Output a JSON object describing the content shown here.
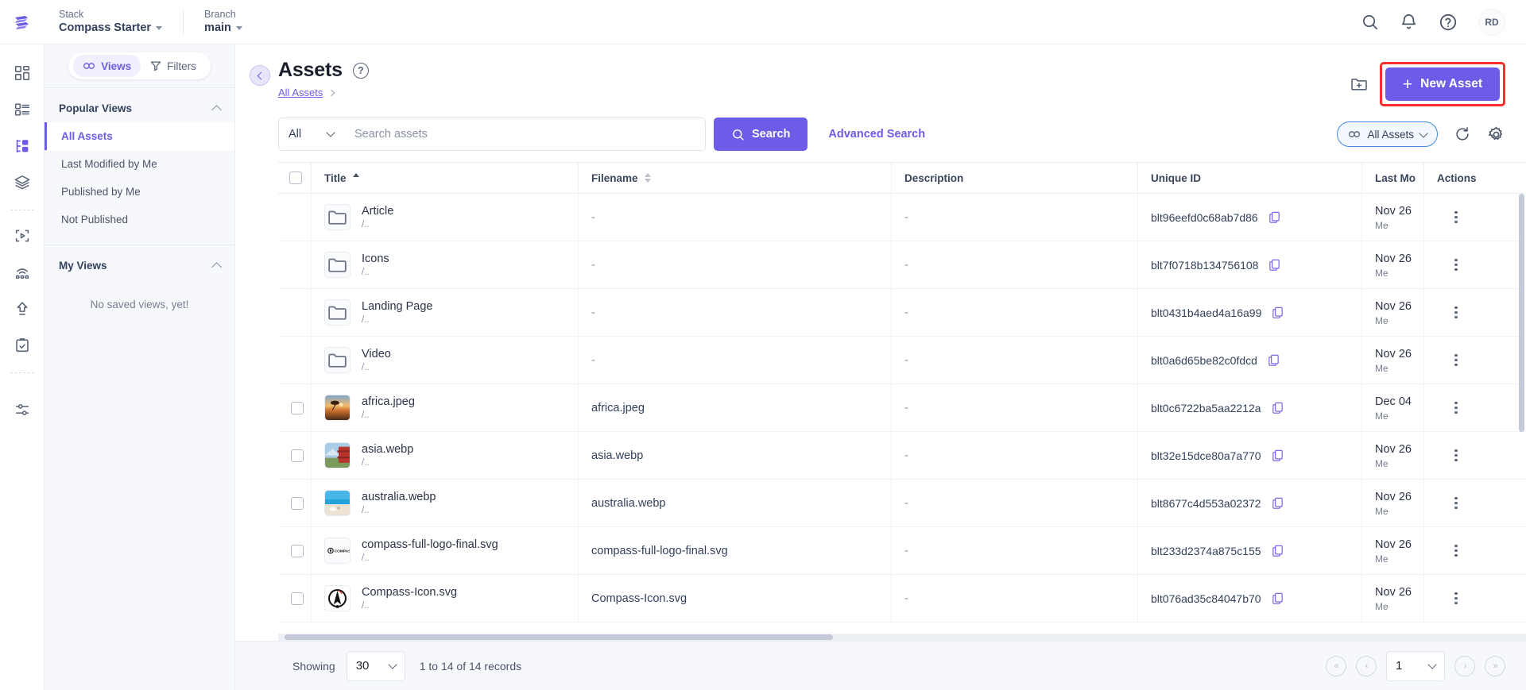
{
  "topbar": {
    "stack_label": "Stack",
    "stack_value": "Compass Starter",
    "branch_label": "Branch",
    "branch_value": "main",
    "avatar_initials": "RD"
  },
  "views_panel": {
    "views_button": "Views",
    "filters_button": "Filters",
    "popular_views_title": "Popular Views",
    "popular_views": [
      {
        "label": "All Assets",
        "active": true
      },
      {
        "label": "Last Modified by Me",
        "active": false
      },
      {
        "label": "Published by Me",
        "active": false
      },
      {
        "label": "Not Published",
        "active": false
      }
    ],
    "my_views_title": "My Views",
    "my_views_empty": "No saved views, yet!"
  },
  "header": {
    "title": "Assets",
    "breadcrumb": "All Assets",
    "new_asset_label": "New Asset",
    "new_asset_highlight_color": "#fc2d2d",
    "accent_color": "#6c5ce7"
  },
  "search": {
    "scope_value": "All",
    "placeholder": "Search assets",
    "value": "",
    "search_button": "Search",
    "advanced_search": "Advanced Search",
    "view_chip": "All Assets"
  },
  "table": {
    "columns": [
      {
        "key": "title",
        "label": "Title"
      },
      {
        "key": "filename",
        "label": "Filename"
      },
      {
        "key": "description",
        "label": "Description"
      },
      {
        "key": "unique_id",
        "label": "Unique ID"
      },
      {
        "key": "last_modified",
        "label": "Last Mo"
      },
      {
        "key": "actions",
        "label": "Actions"
      }
    ],
    "rows": [
      {
        "type": "folder",
        "title": "Article",
        "path": "/..",
        "filename": "-",
        "description": "-",
        "unique_id": "blt96eefd0c68ab7d86",
        "modified_date": "Nov 26",
        "modified_by": "Me"
      },
      {
        "type": "folder",
        "title": "Icons",
        "path": "/..",
        "filename": "-",
        "description": "-",
        "unique_id": "blt7f0718b134756108",
        "modified_date": "Nov 26",
        "modified_by": "Me"
      },
      {
        "type": "folder",
        "title": "Landing Page",
        "path": "/..",
        "filename": "-",
        "description": "-",
        "unique_id": "blt0431b4aed4a16a99",
        "modified_date": "Nov 26",
        "modified_by": "Me"
      },
      {
        "type": "folder",
        "title": "Video",
        "path": "/..",
        "filename": "-",
        "description": "-",
        "unique_id": "blt0a6d65be82c0fdcd",
        "modified_date": "Nov 26",
        "modified_by": "Me"
      },
      {
        "type": "image-africa",
        "title": "africa.jpeg",
        "path": "/..",
        "filename": "africa.jpeg",
        "description": "-",
        "unique_id": "blt0c6722ba5aa2212a",
        "modified_date": "Dec 04",
        "modified_by": "Me"
      },
      {
        "type": "image-asia",
        "title": "asia.webp",
        "path": "/..",
        "filename": "asia.webp",
        "description": "-",
        "unique_id": "blt32e15dce80a7a770",
        "modified_date": "Nov 26",
        "modified_by": "Me"
      },
      {
        "type": "image-australia",
        "title": "australia.webp",
        "path": "/..",
        "filename": "australia.webp",
        "description": "-",
        "unique_id": "blt8677c4d553a02372",
        "modified_date": "Nov 26",
        "modified_by": "Me"
      },
      {
        "type": "logo-compass",
        "title": "compass-full-logo-final.svg",
        "path": "/..",
        "filename": "compass-full-logo-final.svg",
        "description": "-",
        "unique_id": "blt233d2374a875c155",
        "modified_date": "Nov 26",
        "modified_by": "Me"
      },
      {
        "type": "icon-compass",
        "title": "Compass-Icon.svg",
        "path": "/..",
        "filename": "Compass-Icon.svg",
        "description": "-",
        "unique_id": "blt076ad35c84047b70",
        "modified_date": "Nov 26",
        "modified_by": "Me"
      }
    ]
  },
  "footer": {
    "showing_label": "Showing",
    "page_size": "30",
    "records_text": "1 to 14 of 14 records",
    "current_page": "1"
  },
  "icons": {
    "logo": "contentstack-logo",
    "search": "search-icon",
    "bell": "bell-icon",
    "help": "help-icon",
    "folder_new": "new-folder-icon",
    "refresh": "refresh-icon",
    "gear": "gear-icon",
    "copy": "copy-icon"
  }
}
